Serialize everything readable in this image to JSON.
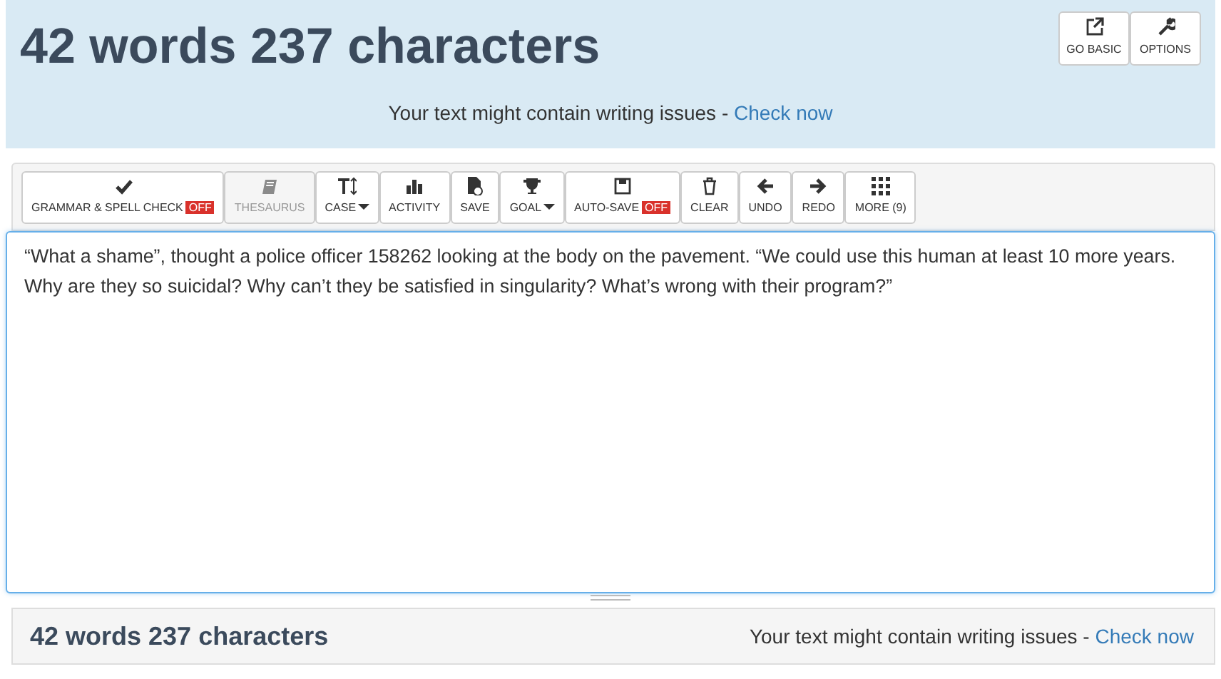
{
  "header": {
    "title": "42 words 237 characters",
    "buttons": [
      {
        "label": "GO BASIC"
      },
      {
        "label": "OPTIONS"
      }
    ],
    "notice": {
      "text": "Your text might contain writing issues - ",
      "link": "Check now"
    }
  },
  "toolbar": [
    {
      "label": "GRAMMAR & SPELL CHECK",
      "badge": "OFF",
      "dropdown": false,
      "disabled": false
    },
    {
      "label": "THESAURUS",
      "dropdown": false,
      "disabled": true
    },
    {
      "label": "CASE",
      "dropdown": true,
      "disabled": false
    },
    {
      "label": "ACTIVITY",
      "dropdown": false,
      "disabled": false
    },
    {
      "label": "SAVE",
      "dropdown": false,
      "disabled": false
    },
    {
      "label": "GOAL",
      "dropdown": true,
      "disabled": false
    },
    {
      "label": "AUTO-SAVE",
      "badge": "OFF",
      "dropdown": false,
      "disabled": false
    },
    {
      "label": "CLEAR",
      "dropdown": false,
      "disabled": false
    },
    {
      "label": "UNDO",
      "dropdown": false,
      "disabled": false
    },
    {
      "label": "REDO",
      "dropdown": false,
      "disabled": false
    },
    {
      "label": "MORE (9)",
      "dropdown": false,
      "disabled": false
    }
  ],
  "editor": {
    "value": "“What a shame”, thought a police officer 158262 looking at the body on the pavement. “We could use this human at least 10 more years. Why are they so suicidal? Why can’t they be satisfied in singularity? What’s wrong with their program?”"
  },
  "footer": {
    "count": "42 words 237 characters",
    "notice": {
      "text": "Your text might contain writing issues - ",
      "link": "Check now"
    }
  }
}
